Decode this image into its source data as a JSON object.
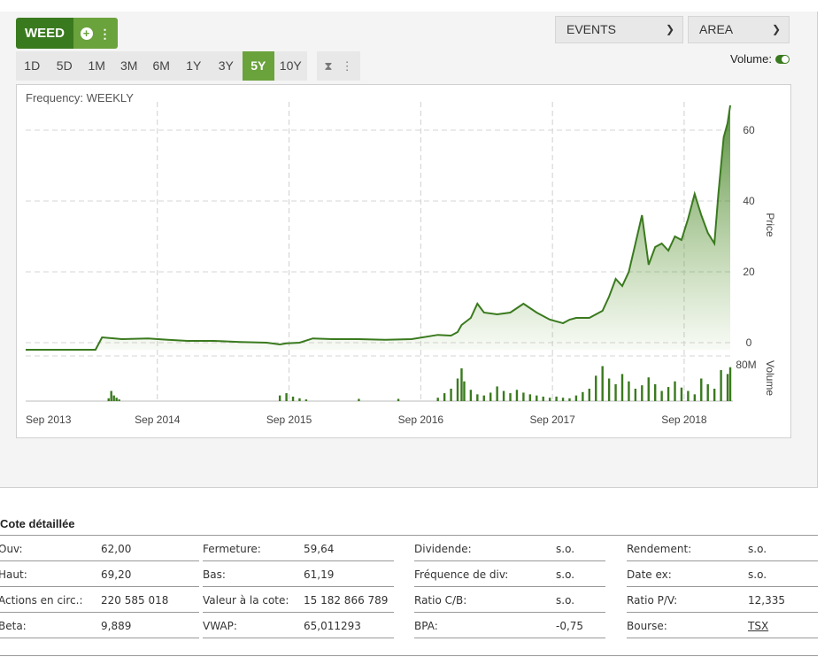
{
  "ticker": {
    "symbol": "WEED",
    "add_icon": "plus-circle-icon",
    "menu_icon": "kebab-icon"
  },
  "periods": [
    "1D",
    "5D",
    "1M",
    "3M",
    "6M",
    "1Y",
    "3Y",
    "5Y",
    "10Y"
  ],
  "active_period": "5Y",
  "dropdowns": {
    "events": "EVENTS",
    "chart_type": "AREA"
  },
  "volume_toggle": {
    "label": "Volume:",
    "on": true
  },
  "frequency": "Frequency: WEEKLY",
  "colors": {
    "accent": "#3a7a1e",
    "accent_light": "#6aa23c"
  },
  "chart_data": {
    "type": "area",
    "title": "",
    "price_axis_label": "Price",
    "volume_axis_label": "Volume",
    "x_ticks": [
      "Sep 2013",
      "Sep 2014",
      "Sep 2015",
      "Sep 2016",
      "Sep 2017",
      "Sep 2018"
    ],
    "y_ticks": [
      0,
      20,
      40,
      60
    ],
    "ylim": [
      -2,
      68
    ],
    "volume_max_label": "80M",
    "x": [
      2013.67,
      2013.8,
      2013.95,
      2014.2,
      2014.25,
      2014.4,
      2014.6,
      2014.75,
      2014.9,
      2015.1,
      2015.3,
      2015.5,
      2015.6,
      2015.65,
      2015.75,
      2015.85,
      2016.0,
      2016.2,
      2016.4,
      2016.6,
      2016.8,
      2016.9,
      2016.95,
      2016.98,
      2017.05,
      2017.1,
      2017.15,
      2017.25,
      2017.35,
      2017.45,
      2017.55,
      2017.65,
      2017.75,
      2017.8,
      2017.85,
      2017.95,
      2018.05,
      2018.1,
      2018.15,
      2018.2,
      2018.25,
      2018.3,
      2018.35,
      2018.4,
      2018.45,
      2018.5,
      2018.55,
      2018.6,
      2018.65,
      2018.7,
      2018.75,
      2018.8,
      2018.85,
      2018.9,
      2018.93,
      2018.97,
      2019.0,
      2019.02
    ],
    "y": [
      -2,
      -2,
      -2,
      -2,
      1.5,
      1,
      1.2,
      0.8,
      0.5,
      0.5,
      0.2,
      0,
      -0.5,
      -0.2,
      0,
      1.2,
      1,
      1,
      0.8,
      1,
      2.2,
      2,
      3,
      5,
      7,
      11,
      8.5,
      8,
      8.5,
      11,
      8.5,
      6.5,
      5.5,
      6.5,
      7,
      7,
      9,
      13,
      18,
      16,
      20,
      28,
      36,
      22,
      27,
      28,
      26,
      30,
      29,
      35,
      42,
      36,
      31,
      28,
      42,
      58,
      62,
      67
    ],
    "volume_x": [
      2014.3,
      2014.32,
      2014.34,
      2014.36,
      2014.38,
      2015.6,
      2015.65,
      2015.7,
      2015.75,
      2015.8,
      2016.2,
      2016.5,
      2016.8,
      2016.85,
      2016.9,
      2016.95,
      2016.98,
      2017.0,
      2017.05,
      2017.1,
      2017.15,
      2017.2,
      2017.25,
      2017.3,
      2017.35,
      2017.4,
      2017.45,
      2017.5,
      2017.55,
      2017.6,
      2017.65,
      2017.7,
      2017.75,
      2017.8,
      2017.85,
      2017.9,
      2017.95,
      2018.0,
      2018.05,
      2018.1,
      2018.15,
      2018.2,
      2018.25,
      2018.3,
      2018.35,
      2018.4,
      2018.45,
      2018.5,
      2018.55,
      2018.6,
      2018.65,
      2018.7,
      2018.75,
      2018.8,
      2018.85,
      2018.9,
      2018.95,
      2019.0,
      2019.02
    ],
    "volume": [
      5,
      18,
      10,
      6,
      3,
      10,
      14,
      8,
      5,
      3,
      4,
      4,
      6,
      14,
      22,
      40,
      58,
      35,
      20,
      12,
      10,
      15,
      26,
      18,
      14,
      20,
      15,
      12,
      10,
      8,
      6,
      8,
      6,
      5,
      10,
      16,
      22,
      45,
      62,
      40,
      30,
      48,
      35,
      22,
      28,
      42,
      30,
      18,
      25,
      35,
      24,
      18,
      12,
      40,
      30,
      22,
      55,
      48,
      60
    ],
    "volume_ylim": [
      0,
      80
    ]
  },
  "quote": {
    "title": "Cote détaillée",
    "rows": [
      [
        {
          "label": "Ouv:",
          "value": "62,00"
        },
        {
          "label": "Fermeture:",
          "value": "59,64"
        },
        {
          "label": "Dividende:",
          "value": "s.o."
        },
        {
          "label": "Rendement:",
          "value": "s.o."
        }
      ],
      [
        {
          "label": "Haut:",
          "value": "69,20"
        },
        {
          "label": "Bas:",
          "value": "61,19"
        },
        {
          "label": "Fréquence de div:",
          "value": "s.o."
        },
        {
          "label": "Date ex:",
          "value": "s.o."
        }
      ],
      [
        {
          "label": "Actions en circ.:",
          "value": "220 585 018"
        },
        {
          "label": "Valeur à la cote:",
          "value": "15 182 866 789"
        },
        {
          "label": "Ratio C/B:",
          "value": "s.o."
        },
        {
          "label": "Ratio P/V:",
          "value": "12,335"
        }
      ],
      [
        {
          "label": "Beta:",
          "value": "9,889"
        },
        {
          "label": "VWAP:",
          "value": "65,011293"
        },
        {
          "label": "BPA:",
          "value": "-0,75"
        },
        {
          "label": "Bourse:",
          "value": "TSX"
        }
      ]
    ]
  }
}
